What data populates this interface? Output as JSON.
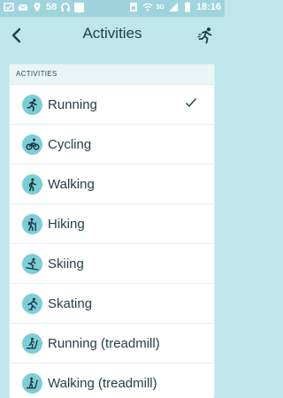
{
  "status_bar": {
    "notification_count": "58",
    "network_type": "3G",
    "time": "18:16"
  },
  "header": {
    "title": "Activities",
    "back_icon": "chevron-left-icon",
    "action_icon": "running-figure-icon"
  },
  "section": {
    "label": "ACTIVITIES"
  },
  "activities": [
    {
      "label": "Running",
      "icon": "running-icon",
      "selected": true
    },
    {
      "label": "Cycling",
      "icon": "cycling-icon",
      "selected": false
    },
    {
      "label": "Walking",
      "icon": "walking-icon",
      "selected": false
    },
    {
      "label": "Hiking",
      "icon": "hiking-icon",
      "selected": false
    },
    {
      "label": "Skiing",
      "icon": "skiing-icon",
      "selected": false
    },
    {
      "label": "Skating",
      "icon": "skating-icon",
      "selected": false
    },
    {
      "label": "Running (treadmill)",
      "icon": "treadmill-running-icon",
      "selected": false
    },
    {
      "label": "Walking (treadmill)",
      "icon": "treadmill-walking-icon",
      "selected": false
    }
  ],
  "colors": {
    "background": "#bfe6ea",
    "statusbar": "#9fd4dc",
    "icon_circle": "#7ccdd8",
    "text": "#1e3f46"
  }
}
